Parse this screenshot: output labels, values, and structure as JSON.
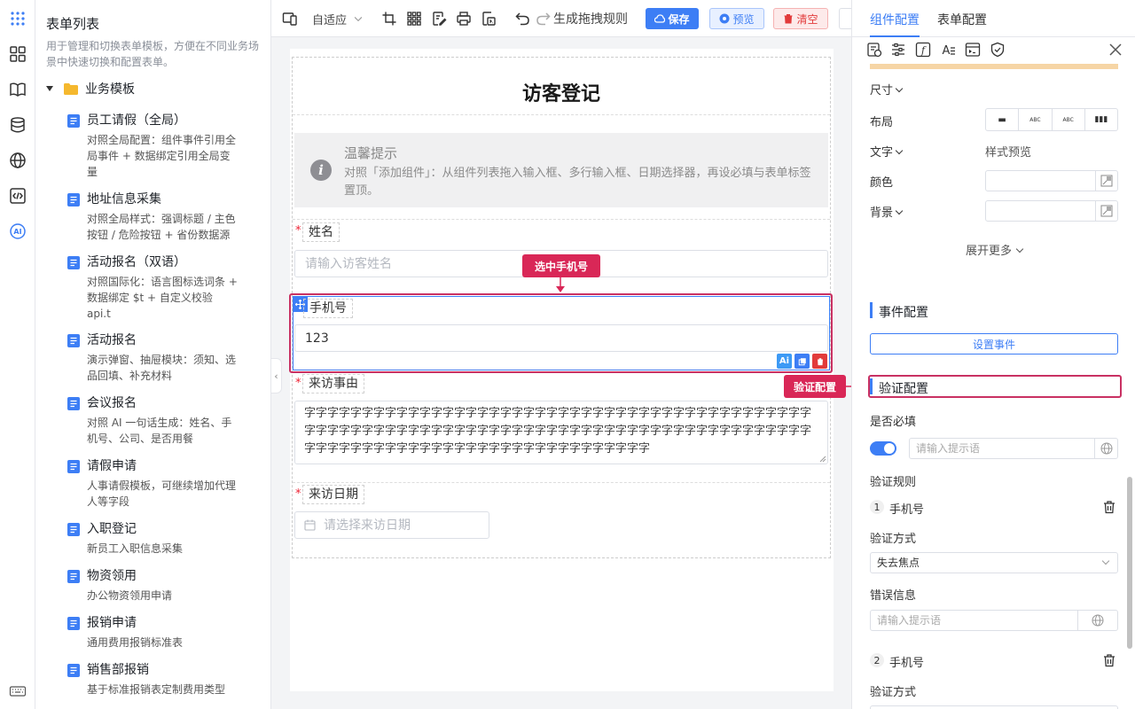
{
  "template_panel": {
    "title": "表单列表",
    "description": "用于管理和切换表单模板，方便在不同业务场景中快速切换和配置表单。",
    "folder": "业务模板",
    "items": [
      {
        "name": "员工请假（全局）",
        "desc": "对照全局配置：组件事件引用全局事件 + 数据绑定引用全局变量"
      },
      {
        "name": "地址信息采集",
        "desc": "对照全局样式：强调标题 / 主色按钮 / 危险按钮 + 省份数据源"
      },
      {
        "name": "活动报名（双语）",
        "desc": "对照国际化：语言图标选词条 + 数据绑定 $t + 自定义校验 api.t"
      },
      {
        "name": "活动报名",
        "desc": "演示弹窗、抽屉模块：须知、选品回填、补充材料"
      },
      {
        "name": "会议报名",
        "desc": "对照 AI 一句话生成：姓名、手机号、公司、是否用餐"
      },
      {
        "name": "请假申请",
        "desc": "人事请假模板，可继续增加代理人等字段"
      },
      {
        "name": "入职登记",
        "desc": "新员工入职信息采集"
      },
      {
        "name": "物资领用",
        "desc": "办公物资领用申请"
      },
      {
        "name": "报销申请",
        "desc": "通用费用报销标准表"
      },
      {
        "name": "销售部报销",
        "desc": "基于标准报销表定制费用类型"
      }
    ]
  },
  "toolbar": {
    "adaptive": "自适应",
    "drag_rules": "生成拖拽规则",
    "save": "保存",
    "preview": "预览",
    "clear": "清空"
  },
  "form": {
    "title": "访客登记",
    "tip_title": "温馨提示",
    "tip_text": "对照「添加组件」：从组件列表拖入输入框、多行输入框、日期选择器，再设必填与表单标签置顶。",
    "name_label": "姓名",
    "name_placeholder": "请输入访客姓名",
    "phone_label": "手机号",
    "phone_value": "123",
    "reason_label": "来访事由",
    "reason_value": "字字字字字字字字字字字字字字字字字字字字字字字字字字字字字字字字字字字字字字字字字字字字字字字字字字字字字字字字字字字字字字字字字字字字字字字字字字字字字字字字字字字字字字字字字字字字字字字字字字字字字字字字字字字字字字字字字字字字字字",
    "date_label": "来访日期",
    "date_placeholder": "请选择来访日期"
  },
  "callouts": {
    "selected_phone": "选中手机号",
    "validation": "验证配置"
  },
  "config_panel": {
    "tabs": [
      "组件配置",
      "表单配置"
    ],
    "size_label": "尺寸",
    "layout_label": "布局",
    "layout_options": [
      "▬",
      "ABC",
      "ABC",
      "▮▮▮"
    ],
    "text_label": "文字",
    "style_preview": "样式预览",
    "color_label": "颜色",
    "bg_label": "背景",
    "expand_more": "展开更多",
    "event_section": "事件配置",
    "set_event": "设置事件",
    "validation_section": "验证配置",
    "required_label": "是否必填",
    "hint_placeholder": "请输入提示语",
    "rules_label": "验证规则",
    "rules": [
      {
        "index": "1",
        "name": "手机号",
        "method_label": "验证方式",
        "method": "失去焦点",
        "error_label": "错误信息",
        "error_placeholder": "请输入提示语"
      },
      {
        "index": "2",
        "name": "手机号",
        "method_label": "验证方式"
      }
    ]
  },
  "colors": {
    "primary": "#3d7ef5",
    "danger": "#e23b3b",
    "highlight": "#c93163"
  }
}
